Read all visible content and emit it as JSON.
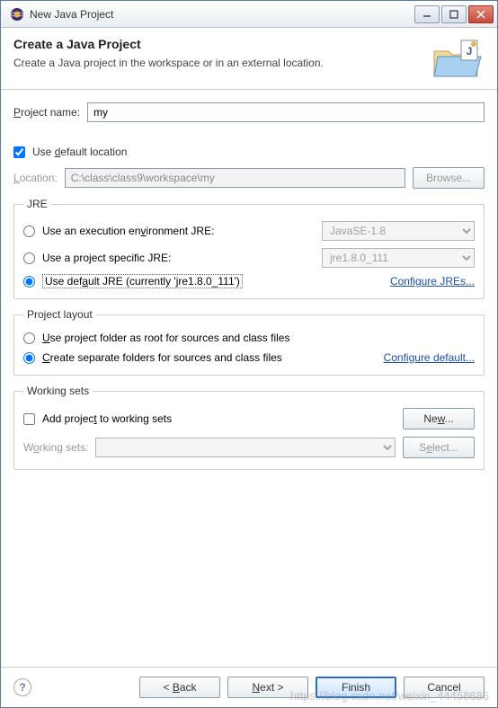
{
  "window": {
    "title": "New Java Project"
  },
  "header": {
    "title": "Create a Java Project",
    "subtitle": "Create a Java project in the workspace or in an external location."
  },
  "project_name": {
    "label": "Project name:",
    "value": "my"
  },
  "default_location": {
    "label": "Use default location",
    "checked": true
  },
  "location": {
    "label": "Location:",
    "value": "C:\\class\\class9\\workspace\\my",
    "browse": "Browse..."
  },
  "jre": {
    "legend": "JRE",
    "opt_env": "Use an execution environment JRE:",
    "env_value": "JavaSE-1.8",
    "opt_specific": "Use a project specific JRE:",
    "specific_value": "jre1.8.0_111",
    "opt_default": "Use default JRE (currently 'jre1.8.0_111')",
    "configure": "Configure JREs..."
  },
  "layout": {
    "legend": "Project layout",
    "opt_root": "Use project folder as root for sources and class files",
    "opt_separate": "Create separate folders for sources and class files",
    "configure": "Configure default..."
  },
  "working_sets": {
    "legend": "Working sets",
    "add_label": "Add project to working sets",
    "new_btn": "New...",
    "ws_label": "Working sets:",
    "select_btn": "Select..."
  },
  "footer": {
    "back": "< Back",
    "next": "Next >",
    "finish": "Finish",
    "cancel": "Cancel"
  },
  "watermark": "https://blog.csdn.net/weixin_44458686"
}
